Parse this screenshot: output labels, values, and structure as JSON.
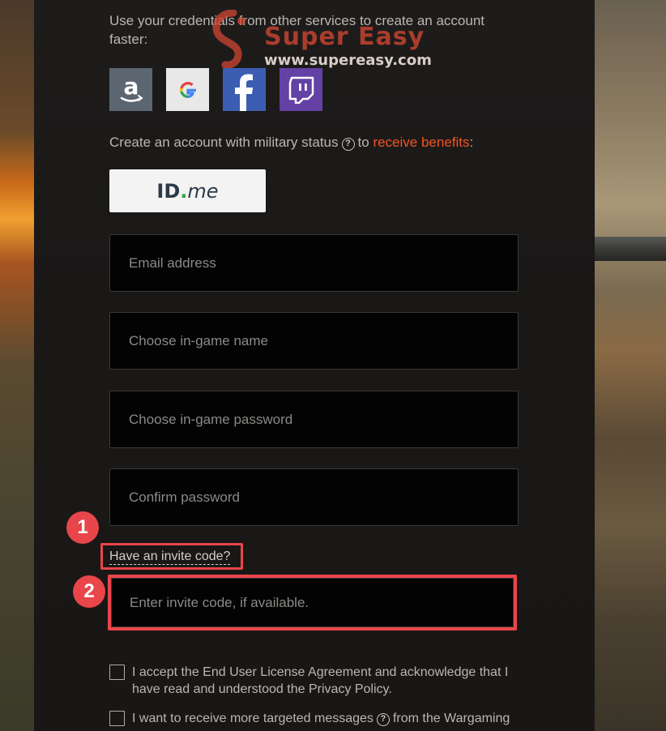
{
  "intro_text": "Use your credentials from other services to create an account faster:",
  "watermark": {
    "title": "Super Easy",
    "url": "www.supereasy.com"
  },
  "social_buttons": [
    {
      "name": "amazon",
      "icon": "amazon-icon",
      "color": "#5b6670"
    },
    {
      "name": "google",
      "icon": "google-icon",
      "color": "#e8e8e8"
    },
    {
      "name": "facebook",
      "icon": "facebook-icon",
      "color": "#3b5db2"
    },
    {
      "name": "twitch",
      "icon": "twitch-icon",
      "color": "#6441a4"
    }
  ],
  "military": {
    "text_before": "Create an account with military status",
    "help_icon": "?",
    "text_middle": "to",
    "link": "receive benefits",
    "text_after": ":",
    "link_color": "#f25322"
  },
  "idme_button": {
    "id": "ID",
    "dot": ".",
    "me": "me"
  },
  "form": {
    "email_placeholder": "Email address",
    "name_placeholder": "Choose in-game name",
    "password_placeholder": "Choose in-game password",
    "confirm_placeholder": "Confirm password",
    "invite_link": "Have an invite code?",
    "invite_placeholder": "Enter invite code, if available."
  },
  "annotations": {
    "step1": "1",
    "step2": "2",
    "highlight_color": "#e8464a"
  },
  "checkboxes": {
    "eula_label": "I accept the End User License Agreement and acknowledge that I have read and understood the Privacy Policy.",
    "messages_label_before": "I want to receive more targeted messages",
    "messages_help": "?",
    "messages_label_after": "from the Wargaming"
  }
}
